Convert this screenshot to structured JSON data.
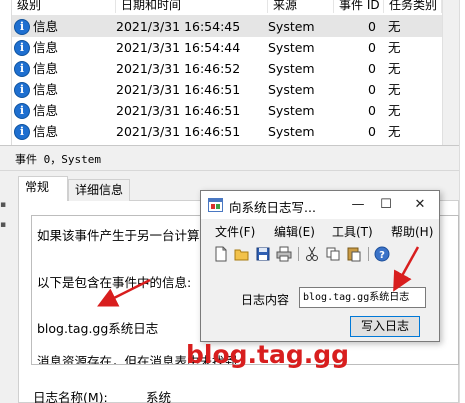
{
  "event_list": {
    "columns": [
      "级别",
      "日期和时间",
      "来源",
      "事件 ID",
      "任务类别"
    ],
    "rows": [
      {
        "level": "信息",
        "datetime": "2021/3/31 16:54:45",
        "source": "System",
        "event_id": "0",
        "task": "无",
        "selected": true
      },
      {
        "level": "信息",
        "datetime": "2021/3/31 16:54:44",
        "source": "System",
        "event_id": "0",
        "task": "无"
      },
      {
        "level": "信息",
        "datetime": "2021/3/31 16:46:52",
        "source": "System",
        "event_id": "0",
        "task": "无"
      },
      {
        "level": "信息",
        "datetime": "2021/3/31 16:46:51",
        "source": "System",
        "event_id": "0",
        "task": "无"
      },
      {
        "level": "信息",
        "datetime": "2021/3/31 16:46:51",
        "source": "System",
        "event_id": "0",
        "task": "无"
      },
      {
        "level": "信息",
        "datetime": "2021/3/31 16:46:51",
        "source": "System",
        "event_id": "0",
        "task": "无"
      }
    ]
  },
  "detail": {
    "title": "事件 0，System",
    "tabs": [
      "常规",
      "详细信息"
    ],
    "description_lines": [
      "如果该事件产生于另一台计算机",
      "以下是包含在事件中的信息:",
      "blog.tag.gg系统日志",
      "消息资源存在，但在消息表中未找到"
    ],
    "log_name_label": "日志名称(M):",
    "log_name_value": "系统"
  },
  "dialog": {
    "title": "向系统日志写...",
    "menu": [
      "文件(F)",
      "编辑(E)",
      "工具(T)",
      "帮助(H)"
    ],
    "field_label": "日志内容",
    "field_value": "blog.tag.gg系统日志",
    "button_label": "写入日志"
  },
  "watermark": "blog.tag.gg",
  "colors": {
    "arrow": "#d81e1e",
    "info_icon": "#1e6fd0",
    "selected_row": "#e5e5e5",
    "button_focus_border": "#0078d7"
  }
}
